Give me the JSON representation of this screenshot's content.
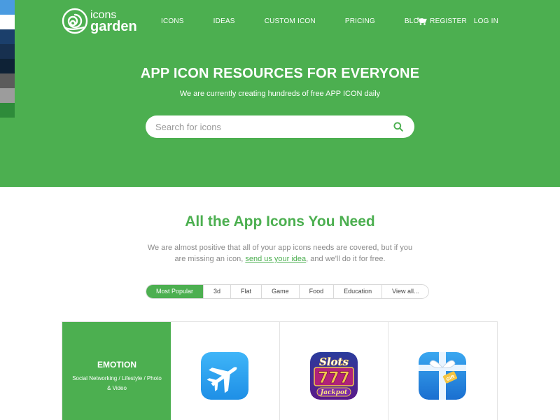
{
  "swatches": [
    "#4a9be0",
    "#ffffff",
    "#1b3f6b",
    "#17304f",
    "#0e2236",
    "#5b5b5b",
    "#9c9c9c",
    "#2e8b3a"
  ],
  "brand": {
    "line1": "icons",
    "line2": "garden",
    "accent": "#4caf50"
  },
  "nav": {
    "items": [
      "ICONS",
      "IDEAS",
      "CUSTOM ICON",
      "PRICING",
      "BLOG"
    ],
    "register": "REGISTER",
    "login": "LOG IN"
  },
  "hero": {
    "title": "APP ICON RESOURCES FOR EVERYONE",
    "subtitle": "We are currently creating hundreds of free APP ICON daily"
  },
  "search": {
    "placeholder": "Search for icons",
    "value": ""
  },
  "section": {
    "title": "All the App Icons You Need",
    "desc_before": "We are almost positive that all of your app icons needs are covered, but if you are missing an icon, ",
    "desc_link": "send us your idea",
    "desc_after": ", and we'll do it for free."
  },
  "filters": [
    "Most Popular",
    "3d",
    "Flat",
    "Game",
    "Food",
    "Education",
    "View all..."
  ],
  "category": {
    "title": "EMOTION",
    "desc": "Social Networking / Lifestyle / Photo & Video"
  },
  "icons": [
    "airplane-app-icon",
    "slots-jackpot-app-icon",
    "gift-box-app-icon"
  ],
  "icon_labels": {
    "slots": "Slots",
    "sevens": "777",
    "jackpot": "Jackpot",
    "gift": "Gift"
  }
}
